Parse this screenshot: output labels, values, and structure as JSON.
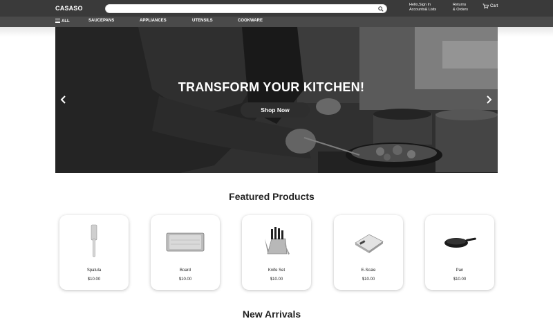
{
  "header": {
    "logo": "CASASO",
    "search_value": "",
    "search_placeholder": "",
    "account_line1": "Hello,Sign In",
    "account_line2": "Accounts& Lists",
    "returns_line1": "Returns",
    "returns_line2": "& Orders",
    "cart_label": "Cart"
  },
  "nav": {
    "all_label": "ALL",
    "items": [
      "SAUCEPANS",
      "APPLIANCES",
      "UTENSILS",
      "COOKWARE"
    ]
  },
  "hero": {
    "title": "TRANSFORM YOUR KITCHEN!",
    "cta": "Shop Now"
  },
  "featured": {
    "title": "Featured Products",
    "products": [
      {
        "name": "Spatula",
        "price": "$10.00",
        "icon": "spatula-icon"
      },
      {
        "name": "Board",
        "price": "$10.00",
        "icon": "cutting-board-icon"
      },
      {
        "name": "Knife Set",
        "price": "$10.00",
        "icon": "knife-set-icon"
      },
      {
        "name": "E-Scale",
        "price": "$10.00",
        "icon": "scale-icon"
      },
      {
        "name": "Pan",
        "price": "$10.00",
        "icon": "pan-icon"
      }
    ]
  },
  "arrivals": {
    "title": "New Arrivals"
  },
  "colors": {
    "header_bg": "#3a3a3a",
    "nav_bg": "#4a4a4a",
    "button_bg": "#2e2e2e"
  }
}
